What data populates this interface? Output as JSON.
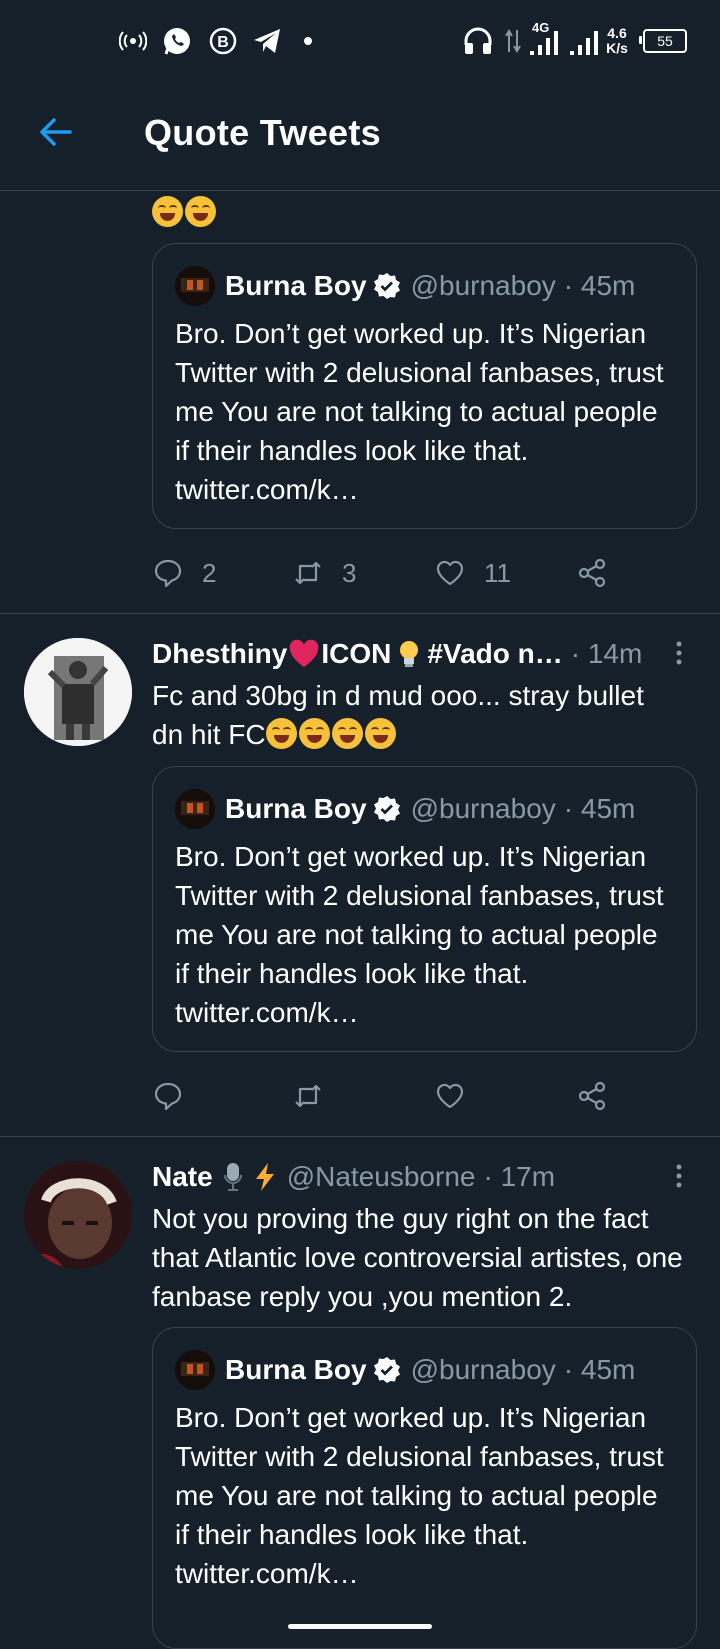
{
  "status_bar": {
    "network_speed_value": "4.6",
    "network_speed_unit": "K/s",
    "network_type": "4G",
    "battery": "55",
    "icons": [
      "hotspot-icon",
      "whatsapp-icon",
      "b-app-icon",
      "telegram-icon",
      "notification-dot-icon",
      "headset-icon",
      "data-transfer-icon",
      "signal-icon",
      "signal-icon",
      "battery-icon"
    ]
  },
  "header": {
    "title": "Quote Tweets",
    "back_icon": "back-arrow-icon",
    "accent": "#1d9bf0"
  },
  "quoted_tweet": {
    "name": "Burna Boy",
    "handle": "@burnaboy",
    "time": "· 45m",
    "text": "Bro. Don’t get worked up. It’s Nigerian Twitter with 2 delusional fanbases, trust me You are not talking to actual people if their handles look like that. twitter.com/k…"
  },
  "tweets": [
    {
      "text_emoji_count": 2,
      "actions": {
        "reply": "2",
        "retweet": "3",
        "like": "11"
      }
    },
    {
      "name_part1": "Dhesthiny",
      "name_part2": "ICON",
      "name_part3": "#Vado n…",
      "time": "· 14m",
      "text_line1": "Fc and 30bg in d mud ooo... stray bullet",
      "text_line2": "dn hit FC",
      "actions": {
        "reply": "",
        "retweet": "",
        "like": ""
      }
    },
    {
      "name": "Nate",
      "handle": "@Nateusborne",
      "time": "· 17m",
      "text": "Not you proving the guy right on the fact that Atlantic love controversial artistes, one fanbase reply you ,you mention 2."
    }
  ],
  "colors": {
    "background": "#15202b",
    "divider": "#38444d",
    "muted": "#8899a6",
    "verified": "#ffffff"
  }
}
